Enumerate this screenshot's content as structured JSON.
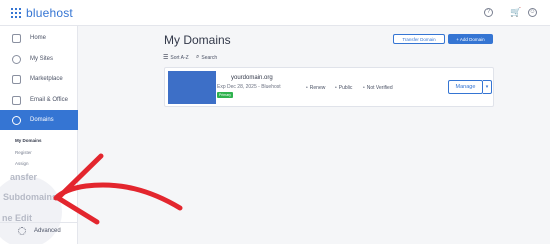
{
  "brand": {
    "name": "bluehost",
    "accent": "#3575d3",
    "arrow_color": "#e3262e"
  },
  "topbar": {
    "icons": [
      "help-icon",
      "cart-icon",
      "account-icon"
    ]
  },
  "sidebar": {
    "items": [
      {
        "label": "Home",
        "icon": "home-icon"
      },
      {
        "label": "My Sites",
        "icon": "wordpress-icon"
      },
      {
        "label": "Marketplace",
        "icon": "tag-icon"
      },
      {
        "label": "Email & Office",
        "icon": "mail-icon"
      },
      {
        "label": "Domains",
        "icon": "globe-icon",
        "active": true
      }
    ],
    "subitems": [
      "My Domains",
      "Register",
      "Assign"
    ],
    "zoomed": {
      "transfer": "ansfer",
      "subdomains": "Subdomains",
      "zone_editor": "ne Edit"
    },
    "advanced": "Advanced"
  },
  "main": {
    "title": "My Domains",
    "transfer_button": "Transfer Domain",
    "add_button": "+ Add Domain",
    "sort_label": "Sort A-Z",
    "search_label": "Search",
    "domain": {
      "name": "yourdomain.org",
      "expiry": "Exp Dec 28, 2025 - Bluehost",
      "badge": "Primary",
      "statuses": [
        "Renew",
        "Public",
        "Not Verified"
      ],
      "manage_label": "Manage",
      "caret": "▾"
    }
  }
}
